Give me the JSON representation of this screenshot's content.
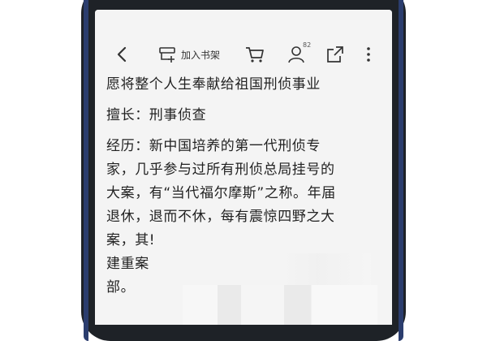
{
  "toolbar": {
    "back_icon": "chevron-left-icon",
    "add_to_shelf_label": "加入书架",
    "cart_icon": "cart-icon",
    "user_count": "82",
    "share_icon": "share-icon",
    "more_icon": "more-vertical-icon"
  },
  "article": {
    "line_top": "愿将整个人生奉献给祖国刑侦事业",
    "specialty": "擅长：刑事侦查",
    "experience_lines": [
      "经历：新中国培养的第一代刑侦专",
      "家，几乎参与过所有刑侦总局挂号的",
      "大案，有“当代福尔摩斯”之称。年届",
      "退休，退而不休，每有震惊四野之大",
      "案，其!",
      "建重案",
      "部。"
    ]
  },
  "colors": {
    "phone_frame": "#1e2227",
    "phone_edge": "#2b3d6e",
    "screen_bg": "#f4f4f4",
    "text": "#222222"
  }
}
